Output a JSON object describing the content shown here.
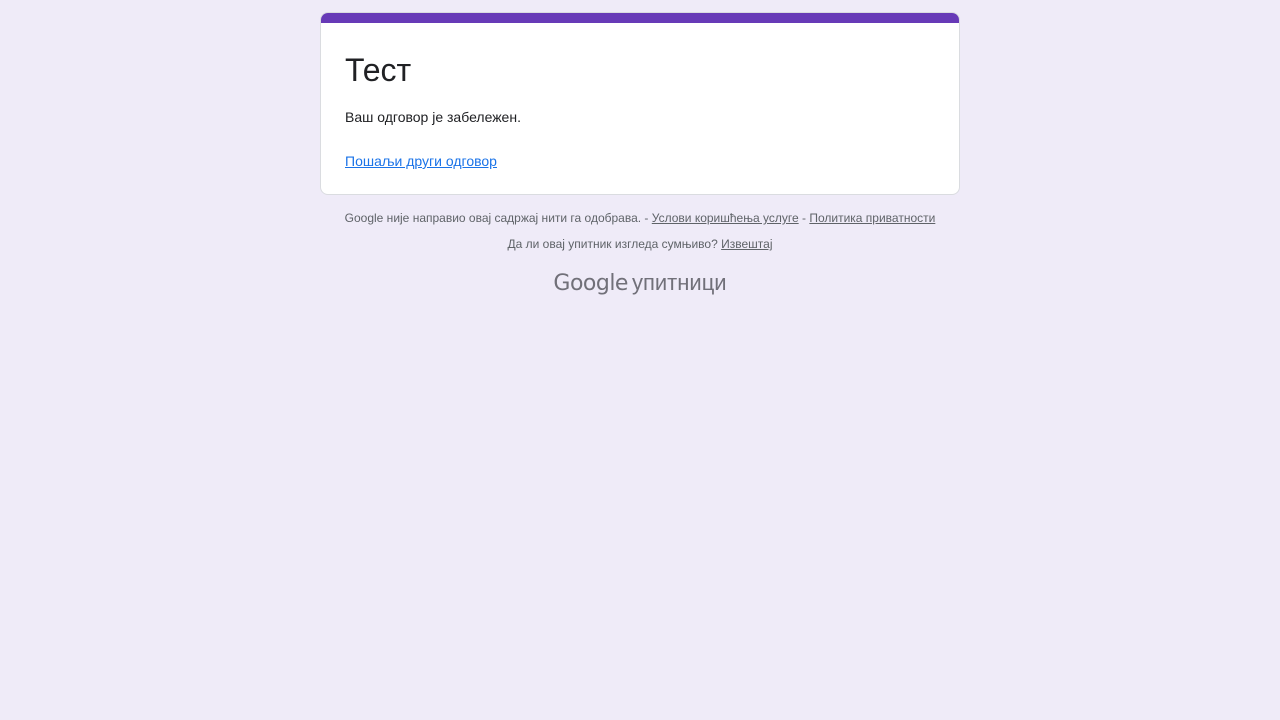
{
  "form": {
    "title": "Тест",
    "confirmation": "Ваш одговор је забележен.",
    "resubmit_link": "Пошаљи други одговор",
    "accent_color": "#673ab7"
  },
  "footer": {
    "disclaimer": "Google није направио овај садржај нити га одобрава. -",
    "terms_link": "Услови коришћења услуге",
    "separator": "-",
    "privacy_link": "Политика приватности",
    "abuse_question": "Да ли овај упитник изгледа сумњиво?",
    "report_link": "Извештај"
  },
  "brand": {
    "google": "Google",
    "product": "упитници"
  }
}
